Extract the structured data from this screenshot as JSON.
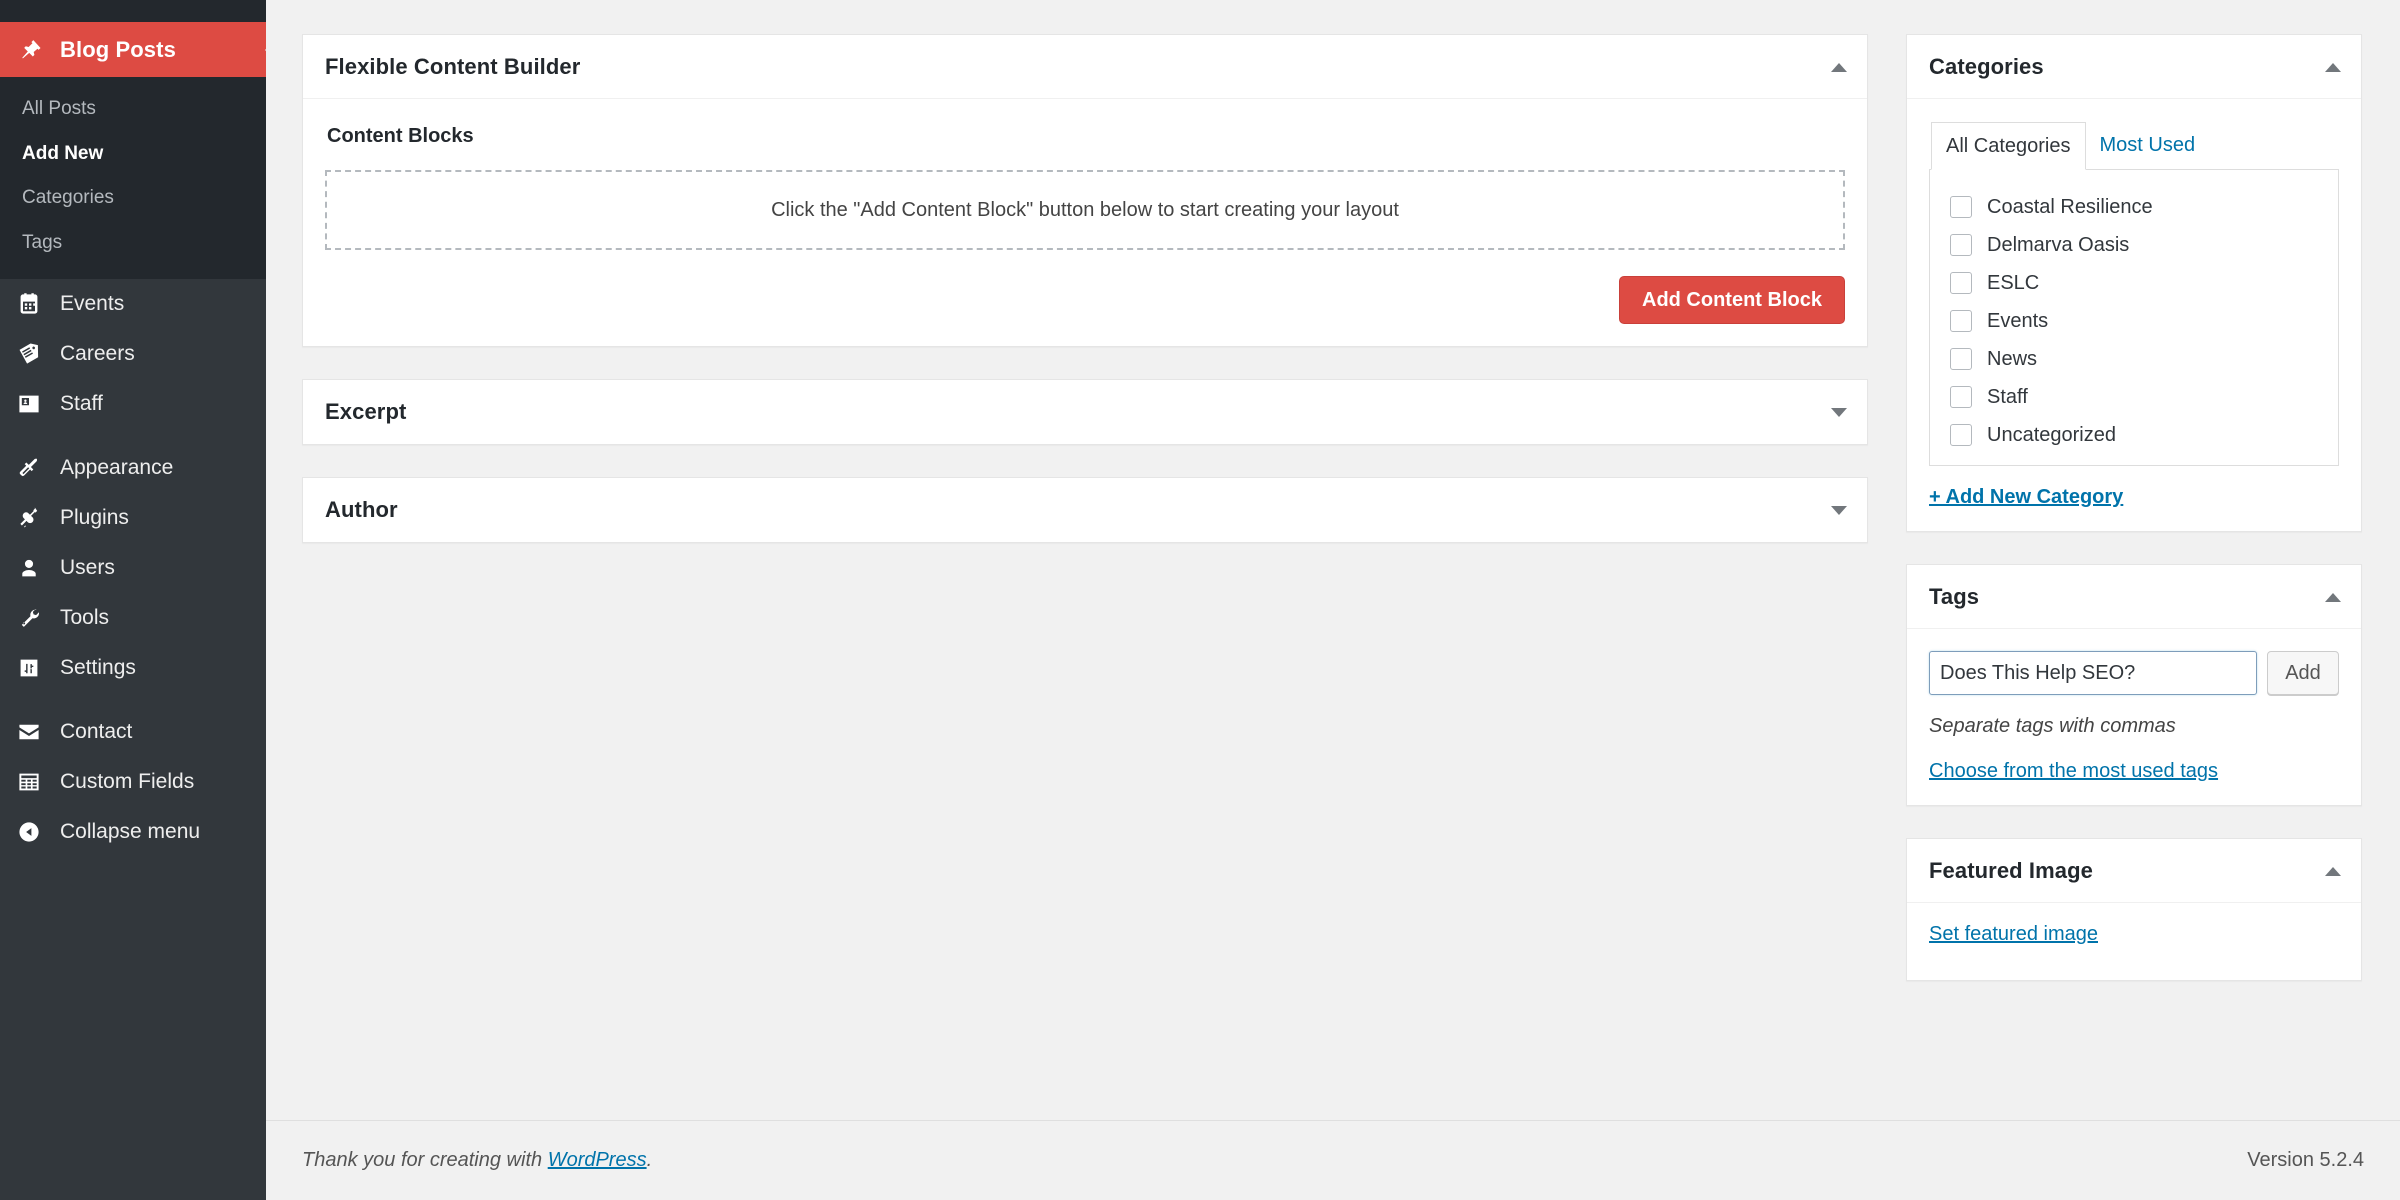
{
  "sidebar": {
    "current_menu": {
      "label": "Blog Posts",
      "icon": "pin-icon"
    },
    "submenu": [
      {
        "label": "All Posts",
        "current": false
      },
      {
        "label": "Add New",
        "current": true
      },
      {
        "label": "Categories",
        "current": false
      },
      {
        "label": "Tags",
        "current": false
      }
    ],
    "group_a": [
      {
        "label": "Events",
        "icon": "calendar-icon"
      },
      {
        "label": "Careers",
        "icon": "tag-icon"
      },
      {
        "label": "Staff",
        "icon": "id-card-icon"
      }
    ],
    "group_b": [
      {
        "label": "Appearance",
        "icon": "paintbrush-icon"
      },
      {
        "label": "Plugins",
        "icon": "plug-icon"
      },
      {
        "label": "Users",
        "icon": "user-icon"
      },
      {
        "label": "Tools",
        "icon": "wrench-icon"
      },
      {
        "label": "Settings",
        "icon": "sliders-icon"
      }
    ],
    "group_c": [
      {
        "label": "Contact",
        "icon": "envelope-icon"
      },
      {
        "label": "Custom Fields",
        "icon": "table-icon"
      }
    ],
    "collapse": {
      "label": "Collapse menu",
      "icon": "collapse-arrow-icon"
    }
  },
  "main": {
    "flexible_content_builder": {
      "title": "Flexible Content Builder",
      "toggle": "collapse",
      "field_label": "Content Blocks",
      "empty_message": "Click the \"Add Content Block\" button below to start creating your layout",
      "add_button": "Add Content Block",
      "add_button_color": "#dd4b43"
    },
    "excerpt": {
      "title": "Excerpt",
      "toggle": "expand"
    },
    "author": {
      "title": "Author",
      "toggle": "expand"
    }
  },
  "side": {
    "categories": {
      "title": "Categories",
      "toggle": "collapse",
      "tabs": [
        {
          "label": "All Categories",
          "active": true
        },
        {
          "label": "Most Used",
          "active": false
        }
      ],
      "items": [
        {
          "label": "Coastal Resilience",
          "checked": false
        },
        {
          "label": "Delmarva Oasis",
          "checked": false
        },
        {
          "label": "ESLC",
          "checked": false
        },
        {
          "label": "Events",
          "checked": false
        },
        {
          "label": "News",
          "checked": false
        },
        {
          "label": "Staff",
          "checked": false
        },
        {
          "label": "Uncategorized",
          "checked": false
        }
      ],
      "add_new_link": "+ Add New Category"
    },
    "tags": {
      "title": "Tags",
      "toggle": "collapse",
      "input_value": "Does This Help SEO?",
      "input_placeholder": "",
      "add_button": "Add",
      "hint": "Separate tags with commas",
      "most_used_link": "Choose from the most used tags"
    },
    "featured_image": {
      "title": "Featured Image",
      "toggle": "collapse",
      "set_link": "Set featured image"
    }
  },
  "footer": {
    "thanks_prefix": "Thank you for creating with ",
    "wordpress_link": "WordPress",
    "thanks_suffix": ".",
    "version": "Version 5.2.4"
  }
}
